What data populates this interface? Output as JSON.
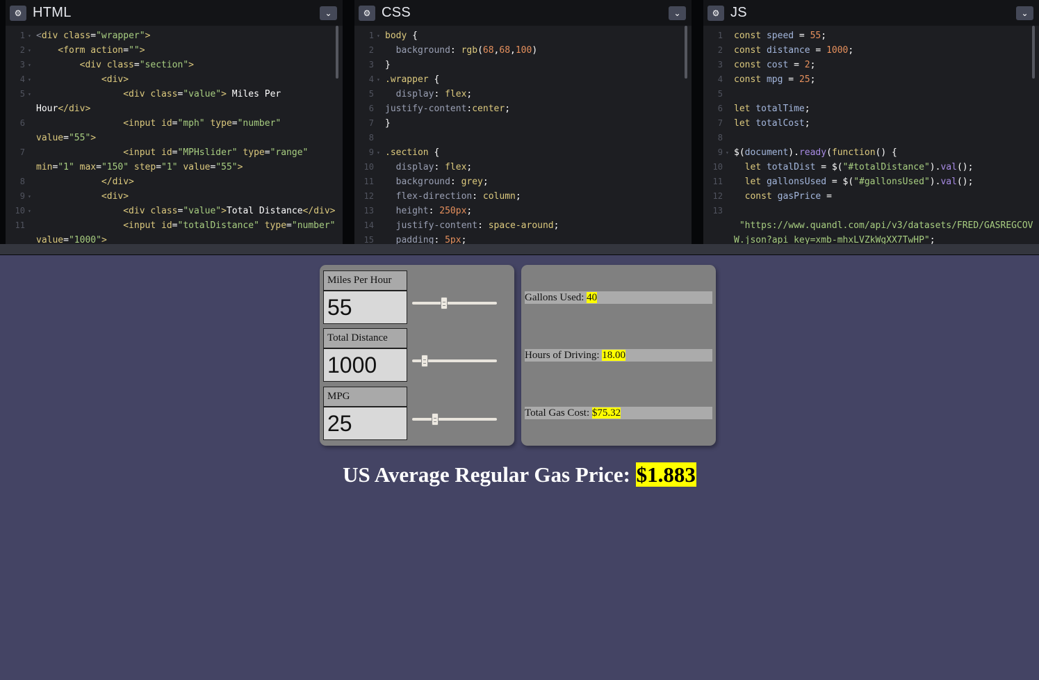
{
  "editors": {
    "html": {
      "title": "HTML",
      "lines": [
        {
          "n": "1",
          "fold": "▾",
          "segs": [
            [
              "c-grey",
              "<"
            ],
            [
              "c-tag",
              "div "
            ],
            [
              "c-attr",
              "class"
            ],
            [
              "c-white",
              "="
            ],
            [
              "c-val",
              "\"wrapper\""
            ],
            [
              "c-tag",
              ">"
            ]
          ]
        },
        {
          "n": "2",
          "fold": "▾",
          "segs": [
            [
              "c-tag",
              "    <form "
            ],
            [
              "c-attr",
              "action"
            ],
            [
              "c-white",
              "="
            ],
            [
              "c-val",
              "\"\""
            ],
            [
              "c-tag",
              ">"
            ]
          ]
        },
        {
          "n": "3",
          "fold": "▾",
          "segs": [
            [
              "c-tag",
              "        <div "
            ],
            [
              "c-attr",
              "class"
            ],
            [
              "c-white",
              "="
            ],
            [
              "c-val",
              "\"section\""
            ],
            [
              "c-tag",
              ">"
            ]
          ]
        },
        {
          "n": "4",
          "fold": "▾",
          "segs": [
            [
              "c-tag",
              "            <div>"
            ]
          ]
        },
        {
          "n": "5",
          "fold": "▾",
          "segs": [
            [
              "c-tag",
              "                <div "
            ],
            [
              "c-attr",
              "class"
            ],
            [
              "c-white",
              "="
            ],
            [
              "c-val",
              "\"value\""
            ],
            [
              "c-tag",
              "> "
            ],
            [
              "c-white",
              "Miles Per"
            ]
          ]
        },
        {
          "n": "",
          "fold": "",
          "segs": [
            [
              "c-white",
              "Hour"
            ],
            [
              "c-tag",
              "</div>"
            ]
          ]
        },
        {
          "n": "6",
          "fold": "",
          "segs": [
            [
              "c-tag",
              "                <input "
            ],
            [
              "c-attr",
              "id"
            ],
            [
              "c-white",
              "="
            ],
            [
              "c-val",
              "\"mph\" "
            ],
            [
              "c-attr",
              "type"
            ],
            [
              "c-white",
              "="
            ],
            [
              "c-val",
              "\"number\""
            ]
          ]
        },
        {
          "n": "",
          "fold": "",
          "segs": [
            [
              "c-attr",
              "value"
            ],
            [
              "c-white",
              "="
            ],
            [
              "c-val",
              "\"55\""
            ],
            [
              "c-tag",
              ">"
            ]
          ]
        },
        {
          "n": "7",
          "fold": "",
          "segs": [
            [
              "c-tag",
              "                <input "
            ],
            [
              "c-attr",
              "id"
            ],
            [
              "c-white",
              "="
            ],
            [
              "c-val",
              "\"MPHslider\" "
            ],
            [
              "c-attr",
              "type"
            ],
            [
              "c-white",
              "="
            ],
            [
              "c-val",
              "\"range\""
            ]
          ]
        },
        {
          "n": "",
          "fold": "",
          "segs": [
            [
              "c-attr",
              "min"
            ],
            [
              "c-white",
              "="
            ],
            [
              "c-val",
              "\"1\" "
            ],
            [
              "c-attr",
              "max"
            ],
            [
              "c-white",
              "="
            ],
            [
              "c-val",
              "\"150\" "
            ],
            [
              "c-attr",
              "step"
            ],
            [
              "c-white",
              "="
            ],
            [
              "c-val",
              "\"1\" "
            ],
            [
              "c-attr",
              "value"
            ],
            [
              "c-white",
              "="
            ],
            [
              "c-val",
              "\"55\""
            ],
            [
              "c-tag",
              ">"
            ]
          ]
        },
        {
          "n": "8",
          "fold": "",
          "segs": [
            [
              "c-tag",
              "            </div>"
            ]
          ]
        },
        {
          "n": "9",
          "fold": "▾",
          "segs": [
            [
              "c-tag",
              "            <div>"
            ]
          ]
        },
        {
          "n": "10",
          "fold": "▾",
          "segs": [
            [
              "c-tag",
              "                <div "
            ],
            [
              "c-attr",
              "class"
            ],
            [
              "c-white",
              "="
            ],
            [
              "c-val",
              "\"value\""
            ],
            [
              "c-tag",
              ">"
            ],
            [
              "c-white",
              "Total Distance"
            ],
            [
              "c-tag",
              "</div>"
            ]
          ]
        },
        {
          "n": "11",
          "fold": "",
          "segs": [
            [
              "c-tag",
              "                <input "
            ],
            [
              "c-attr",
              "id"
            ],
            [
              "c-white",
              "="
            ],
            [
              "c-val",
              "\"totalDistance\" "
            ],
            [
              "c-attr",
              "type"
            ],
            [
              "c-white",
              "="
            ],
            [
              "c-val",
              "\"number\""
            ]
          ]
        },
        {
          "n": "",
          "fold": "",
          "segs": [
            [
              "c-attr",
              "value"
            ],
            [
              "c-white",
              "="
            ],
            [
              "c-val",
              "\"1000\""
            ],
            [
              "c-tag",
              ">"
            ]
          ]
        }
      ]
    },
    "css": {
      "title": "CSS",
      "lines": [
        {
          "n": "1",
          "fold": "▾",
          "segs": [
            [
              "c-key",
              "body "
            ],
            [
              "c-white",
              "{"
            ]
          ]
        },
        {
          "n": "2",
          "fold": "",
          "segs": [
            [
              "c-prop",
              "  background"
            ],
            [
              "c-white",
              ": "
            ],
            [
              "c-key",
              "rgb"
            ],
            [
              "c-white",
              "("
            ],
            [
              "c-num",
              "68"
            ],
            [
              "c-white",
              ","
            ],
            [
              "c-num",
              "68"
            ],
            [
              "c-white",
              ","
            ],
            [
              "c-num",
              "100"
            ],
            [
              "c-white",
              ")"
            ]
          ]
        },
        {
          "n": "3",
          "fold": "",
          "segs": [
            [
              "c-white",
              "}"
            ]
          ]
        },
        {
          "n": "4",
          "fold": "▾",
          "segs": [
            [
              "c-key",
              ".wrapper "
            ],
            [
              "c-white",
              "{"
            ]
          ]
        },
        {
          "n": "5",
          "fold": "",
          "segs": [
            [
              "c-prop",
              "  display"
            ],
            [
              "c-white",
              ": "
            ],
            [
              "c-key",
              "flex"
            ],
            [
              "c-white",
              ";"
            ]
          ]
        },
        {
          "n": "6",
          "fold": "",
          "segs": [
            [
              "c-prop",
              "justify-content"
            ],
            [
              "c-white",
              ":"
            ],
            [
              "c-key",
              "center"
            ],
            [
              "c-white",
              ";"
            ]
          ]
        },
        {
          "n": "7",
          "fold": "",
          "segs": [
            [
              "c-white",
              "}"
            ]
          ]
        },
        {
          "n": "8",
          "fold": "",
          "segs": [
            [
              "c-white",
              ""
            ]
          ]
        },
        {
          "n": "9",
          "fold": "▾",
          "segs": [
            [
              "c-key",
              ".section "
            ],
            [
              "c-white",
              "{"
            ]
          ]
        },
        {
          "n": "10",
          "fold": "",
          "segs": [
            [
              "c-prop",
              "  display"
            ],
            [
              "c-white",
              ": "
            ],
            [
              "c-key",
              "flex"
            ],
            [
              "c-white",
              ";"
            ]
          ]
        },
        {
          "n": "11",
          "fold": "",
          "segs": [
            [
              "c-prop",
              "  background"
            ],
            [
              "c-white",
              ": "
            ],
            [
              "c-key",
              "grey"
            ],
            [
              "c-white",
              ";"
            ]
          ]
        },
        {
          "n": "12",
          "fold": "",
          "segs": [
            [
              "c-prop",
              "  flex-direction"
            ],
            [
              "c-white",
              ": "
            ],
            [
              "c-key",
              "column"
            ],
            [
              "c-white",
              ";"
            ]
          ]
        },
        {
          "n": "13",
          "fold": "",
          "segs": [
            [
              "c-prop",
              "  height"
            ],
            [
              "c-white",
              ": "
            ],
            [
              "c-num",
              "250px"
            ],
            [
              "c-white",
              ";"
            ]
          ]
        },
        {
          "n": "14",
          "fold": "",
          "segs": [
            [
              "c-prop",
              "  justify-content"
            ],
            [
              "c-white",
              ": "
            ],
            [
              "c-key",
              "space-around"
            ],
            [
              "c-white",
              ";"
            ]
          ]
        },
        {
          "n": "15",
          "fold": "",
          "segs": [
            [
              "c-prop",
              "  padding"
            ],
            [
              "c-white",
              ": "
            ],
            [
              "c-num",
              "5px"
            ],
            [
              "c-white",
              ";"
            ]
          ]
        }
      ]
    },
    "js": {
      "title": "JS",
      "lines": [
        {
          "n": "1",
          "fold": "",
          "segs": [
            [
              "c-key",
              "const "
            ],
            [
              "c-var",
              "speed"
            ],
            [
              "c-white",
              " = "
            ],
            [
              "c-num",
              "55"
            ],
            [
              "c-white",
              ";"
            ]
          ]
        },
        {
          "n": "2",
          "fold": "",
          "segs": [
            [
              "c-key",
              "const "
            ],
            [
              "c-var",
              "distance"
            ],
            [
              "c-white",
              " = "
            ],
            [
              "c-num",
              "1000"
            ],
            [
              "c-white",
              ";"
            ]
          ]
        },
        {
          "n": "3",
          "fold": "",
          "segs": [
            [
              "c-key",
              "const "
            ],
            [
              "c-var",
              "cost"
            ],
            [
              "c-white",
              " = "
            ],
            [
              "c-num",
              "2"
            ],
            [
              "c-white",
              ";"
            ]
          ]
        },
        {
          "n": "4",
          "fold": "",
          "segs": [
            [
              "c-key",
              "const "
            ],
            [
              "c-var",
              "mpg"
            ],
            [
              "c-white",
              " = "
            ],
            [
              "c-num",
              "25"
            ],
            [
              "c-white",
              ";"
            ]
          ]
        },
        {
          "n": "5",
          "fold": "",
          "segs": [
            [
              "c-white",
              ""
            ]
          ]
        },
        {
          "n": "6",
          "fold": "",
          "segs": [
            [
              "c-key",
              "let "
            ],
            [
              "c-var",
              "totalTime"
            ],
            [
              "c-white",
              ";"
            ]
          ]
        },
        {
          "n": "7",
          "fold": "",
          "segs": [
            [
              "c-key",
              "let "
            ],
            [
              "c-var",
              "totalCost"
            ],
            [
              "c-white",
              ";"
            ]
          ]
        },
        {
          "n": "8",
          "fold": "",
          "segs": [
            [
              "c-white",
              ""
            ]
          ]
        },
        {
          "n": "9",
          "fold": "▾",
          "segs": [
            [
              "c-white",
              "$("
            ],
            [
              "c-var",
              "document"
            ],
            [
              "c-white",
              ")."
            ],
            [
              "c-fn",
              "ready"
            ],
            [
              "c-white",
              "("
            ],
            [
              "c-key",
              "function"
            ],
            [
              "c-white",
              "() {"
            ]
          ]
        },
        {
          "n": "10",
          "fold": "",
          "segs": [
            [
              "c-key",
              "  let "
            ],
            [
              "c-var",
              "totalDist"
            ],
            [
              "c-white",
              " = $("
            ],
            [
              "c-val",
              "\"#totalDistance\""
            ],
            [
              "c-white",
              ")."
            ],
            [
              "c-fn",
              "val"
            ],
            [
              "c-white",
              "();"
            ]
          ]
        },
        {
          "n": "11",
          "fold": "",
          "segs": [
            [
              "c-key",
              "  let "
            ],
            [
              "c-var",
              "gallonsUsed"
            ],
            [
              "c-white",
              " = $("
            ],
            [
              "c-val",
              "\"#gallonsUsed\""
            ],
            [
              "c-white",
              ")."
            ],
            [
              "c-fn",
              "val"
            ],
            [
              "c-white",
              "();"
            ]
          ]
        },
        {
          "n": "12",
          "fold": "",
          "segs": [
            [
              "c-key",
              "  const "
            ],
            [
              "c-var",
              "gasPrice"
            ],
            [
              "c-white",
              " ="
            ]
          ]
        },
        {
          "n": "13",
          "fold": "",
          "segs": [
            [
              "c-white",
              ""
            ]
          ]
        },
        {
          "n": "",
          "fold": "",
          "segs": [
            [
              "c-val",
              " \"https://www.quandl.com/api/v3/datasets/FRED/GASREGCOV"
            ]
          ]
        },
        {
          "n": "",
          "fold": "",
          "segs": [
            [
              "c-val",
              "W.json?api_key=xmb-mhxLVZkWgXX7TwHP\""
            ],
            [
              "c-white",
              ";"
            ]
          ]
        }
      ]
    }
  },
  "result": {
    "inputs": [
      {
        "label": "Miles Per Hour",
        "value": "55",
        "slider": {
          "min": 1,
          "max": 150,
          "value": 55
        }
      },
      {
        "label": "Total Distance",
        "value": "1000",
        "slider": {
          "min": 1,
          "max": 10000,
          "value": 1000
        }
      },
      {
        "label": "MPG",
        "value": "25",
        "slider": {
          "min": 1,
          "max": 100,
          "value": 25
        }
      }
    ],
    "outputs": [
      {
        "label": "Gallons Used: ",
        "value": "40"
      },
      {
        "label": "Hours of Driving: ",
        "value": "18.00"
      },
      {
        "label": "Total Gas Cost: ",
        "value": "$75.32"
      }
    ],
    "gas_label": "US Average Regular Gas Price: ",
    "gas_price": "$1.883"
  },
  "colors": {
    "page_bg": "#444464",
    "section_bg": "#808080",
    "highlight": "#ffff00"
  },
  "icons": {
    "settings": "gear-icon",
    "collapse": "chevron-down-icon"
  }
}
